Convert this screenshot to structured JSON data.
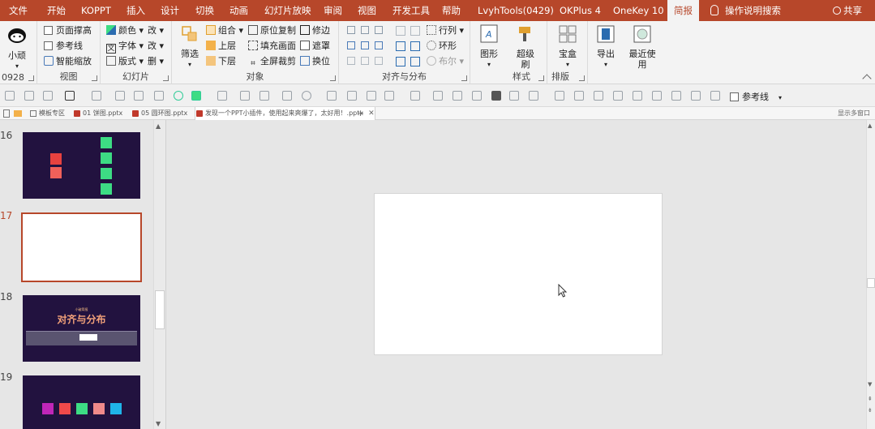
{
  "menu": {
    "tabs": [
      "文件",
      "开始",
      "KOPPT",
      "插入",
      "设计",
      "切换",
      "动画",
      "幻灯片放映",
      "审阅",
      "视图",
      "开发工具",
      "帮助",
      "LvyhTools(0429)",
      "OKPlus 4",
      "OneKey 10",
      "简报"
    ],
    "active_tab": "简报",
    "search_label": "操作说明搜索",
    "share_label": "共享"
  },
  "ribbon": {
    "left_label_partial": "0928",
    "avatar_label": "小顽",
    "view": {
      "items": [
        "页面撑高",
        "参考线",
        "智能缩放"
      ],
      "label": "视图"
    },
    "slides": {
      "color_label": "颜色",
      "font_label": "字体",
      "layout_label": "版式",
      "modify_label": "改",
      "delete_label": "删",
      "label": "幻灯片"
    },
    "object": {
      "filter_label": "筛选",
      "combine_label": "组合",
      "up_label": "上层",
      "down_label": "下层",
      "copy_in_place_label": "原位复制",
      "fill_canvas_label": "填充画面",
      "fullscreen_crop_label": "全屏裁剪",
      "trim_label": "修边",
      "mask_label": "遮罩",
      "swap_label": "换位",
      "label": "对象"
    },
    "align": {
      "row_col_label": "行列",
      "ring_label": "环形",
      "boolean_label": "布尔",
      "label": "对齐与分布"
    },
    "style": {
      "shape_label": "图形",
      "brush_label": "超级刷",
      "label": "样式"
    },
    "arrange": {
      "box_label": "宝盒",
      "label": "排版"
    },
    "export_label": "导出",
    "recent_label": "最近使用"
  },
  "quickbar": {
    "reference_label": "参考线"
  },
  "doc_tabs": {
    "items": [
      {
        "label": "模板专区"
      },
      {
        "label": "01 饼图.pptx"
      },
      {
        "label": "05 圆环图.pptx"
      },
      {
        "label": "发现一个PPT小插件，使用起来爽爆了，太好用！.pptx"
      }
    ],
    "add_label": "+",
    "right_label": "显示多窗口"
  },
  "slides": {
    "numbers": [
      "16",
      "17",
      "18",
      "19"
    ],
    "selected": "17",
    "slide18_small_title": "小破简报",
    "slide18_title": "对齐与分布"
  },
  "colors": {
    "brand": "#b7472a",
    "thumb_bg": "#22123f",
    "red_block": "#e8423f",
    "green_block": "#3ddc84"
  }
}
